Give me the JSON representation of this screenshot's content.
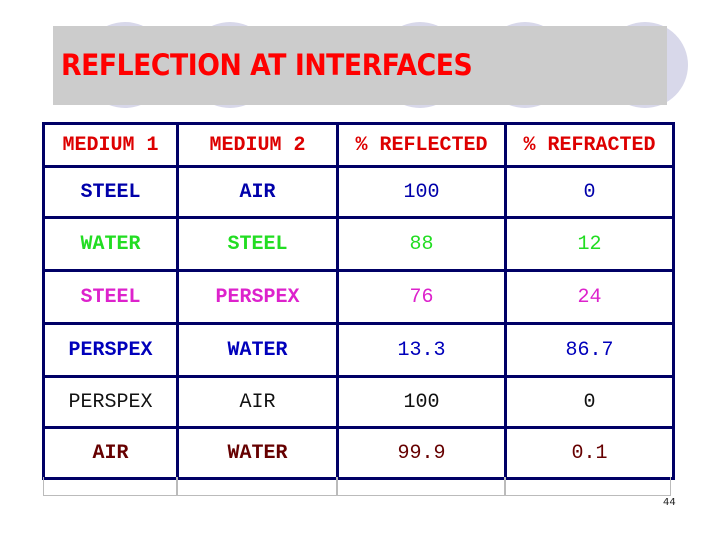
{
  "slide": {
    "title": "REFLECTION AT INTERFACES",
    "page_number": "44",
    "title_color": "#ff0000",
    "header_color": "#dd0000",
    "grid_color": "#000066"
  },
  "table": {
    "headers": [
      "MEDIUM 1",
      "MEDIUM 2",
      "% REFLECTED",
      "% REFRACTED"
    ],
    "rows": [
      {
        "medium1": "STEEL",
        "medium2": "AIR",
        "reflected": "100",
        "refracted": "0",
        "color": "#0000aa"
      },
      {
        "medium1": "WATER",
        "medium2": "STEEL",
        "reflected": "88",
        "refracted": "12",
        "color": "#22dd22"
      },
      {
        "medium1": "STEEL",
        "medium2": "PERSPEX",
        "reflected": "76",
        "refracted": "24",
        "color": "#dd22cc"
      },
      {
        "medium1": "PERSPEX",
        "medium2": "WATER",
        "reflected": "13.3",
        "refracted": "86.7",
        "color": "#0000bb"
      },
      {
        "medium1": "PERSPEX",
        "medium2": "AIR",
        "reflected": "100",
        "refracted": "0",
        "color": "#111111"
      },
      {
        "medium1": "AIR",
        "medium2": "WATER",
        "reflected": "99.9",
        "refracted": "0.1",
        "color": "#660000"
      }
    ]
  }
}
